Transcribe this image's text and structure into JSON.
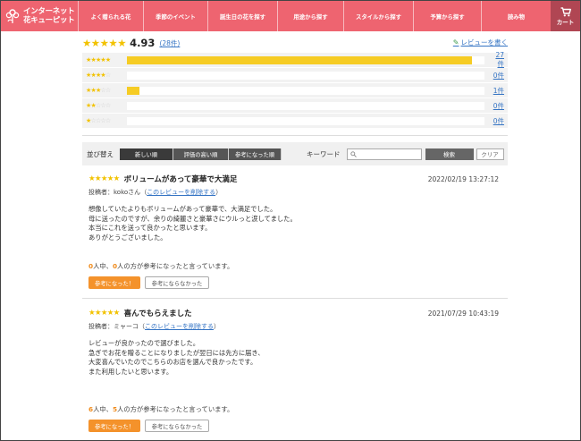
{
  "header": {
    "logo_line1": "インターネット",
    "logo_line2": "花キューピット",
    "nav": [
      "よく贈られる花",
      "季節のイベント",
      "誕生日の花を探す",
      "用途から探す",
      "スタイルから探す",
      "予算から探す",
      "読み物"
    ],
    "cart_label": "カート",
    "cart_icon": "shopping-cart-icon"
  },
  "summary": {
    "rating": 4.93,
    "rating_text": "4.93",
    "stars_filled": 5,
    "review_count_text": "(28件)",
    "write_review_label": "レビューを書く",
    "write_review_icon": "pencil-icon"
  },
  "distribution": [
    {
      "stars": 5,
      "count": 27,
      "count_text": "27件"
    },
    {
      "stars": 4,
      "count": 0,
      "count_text": "0件"
    },
    {
      "stars": 3,
      "count": 1,
      "count_text": "1件"
    },
    {
      "stars": 2,
      "count": 0,
      "count_text": "0件"
    },
    {
      "stars": 1,
      "count": 0,
      "count_text": "0件"
    }
  ],
  "sort": {
    "label": "並び替え",
    "options": [
      "新しい順",
      "評価の高い順",
      "参考になった順"
    ],
    "active": 0,
    "keyword_label": "キーワード",
    "keyword_value": "",
    "search_label": "検索",
    "clear_label": "クリア"
  },
  "reviews": [
    {
      "stars": 5,
      "title": "ボリュームがあって豪華で大満足",
      "date": "2022/02/19 13:27:12",
      "author": "投稿者：kokoさん",
      "delete_link": "このレビューを削除する",
      "body": [
        "想像していたよりもボリュームがあって豪華で、大満足でした。",
        "母に送ったのですが、余りの綺麗さと豪華さにウルっと涙してました。",
        "本当にこれを送って良かったと思います。",
        "ありがとうございました。"
      ],
      "helpful_total": "0",
      "helpful_yes": "0",
      "helpful_mid": "人中、",
      "helpful_end": "人の方が参考になったと言っています。",
      "helpful_button": "参考になった！",
      "not_helpful_button": "参考にならなかった"
    },
    {
      "stars": 5,
      "title": "喜んでもらえました",
      "date": "2021/07/29 10:43:19",
      "author": "投稿者：ミャーコ",
      "delete_link": "このレビューを削除する",
      "body": [
        "レビューが良かったので選びました。",
        "急ぎでお花を贈ることになりましたが翌日には先方に届き、",
        "大変喜んでいたのでこちらのお店を選んで良かったです。",
        "また利用したいと思います。"
      ],
      "helpful_total": "6",
      "helpful_yes": "5",
      "helpful_mid": "人中、",
      "helpful_end": "人の方が参考になったと言っています。",
      "helpful_button": "参考になった！",
      "not_helpful_button": "参考にならなかった"
    }
  ],
  "colors": {
    "header_bg": "#ee6470",
    "cart_bg": "#b04653",
    "star": "#f2c200",
    "bar": "#f6cc24",
    "link": "#3574c4",
    "accent_number": "#f08c1e",
    "helpful_button": "#f4922b"
  }
}
